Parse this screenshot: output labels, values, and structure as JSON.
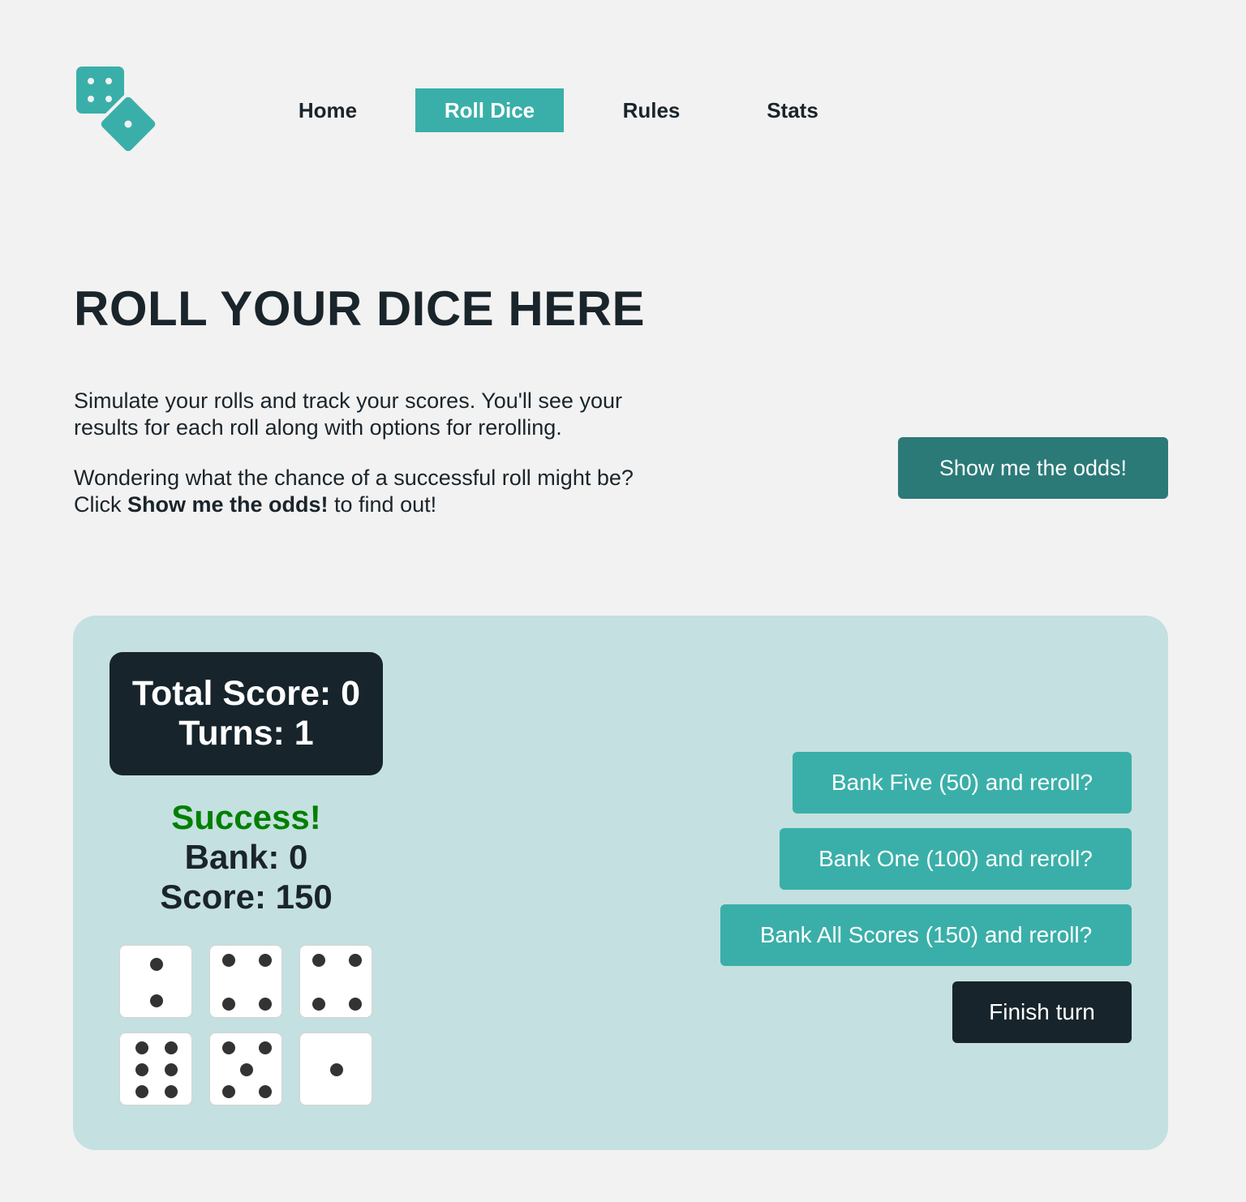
{
  "header": {
    "logo_icon": "dice-logo-icon",
    "nav": [
      {
        "label": "Home",
        "active": false
      },
      {
        "label": "Roll Dice",
        "active": true
      },
      {
        "label": "Rules",
        "active": false
      },
      {
        "label": "Stats",
        "active": false
      }
    ]
  },
  "main": {
    "title": "ROLL YOUR DICE HERE",
    "intro_line1": "Simulate your rolls and track your scores. You'll see your results for each roll along with options for rerolling.",
    "intro_line2_before": "Wondering what the chance of a successful roll might be? Click ",
    "intro_line2_bold": "Show me the odds!",
    "intro_line2_after": " to find out!",
    "odds_button": "Show me the odds!"
  },
  "game": {
    "total_score": "Total Score: 0",
    "turns": "Turns: 1",
    "result_status": "Success!",
    "bank": "Bank: 0",
    "score": "Score: 150",
    "dice": [
      2,
      4,
      4,
      6,
      5,
      1
    ],
    "actions": {
      "bank_five": "Bank Five (50) and reroll?",
      "bank_one": "Bank One (100) and reroll?",
      "bank_all": "Bank All Scores (150) and reroll?",
      "finish": "Finish turn"
    }
  },
  "colors": {
    "accent": "#3aafa9",
    "accent_dark": "#2b7a78",
    "dark": "#17242b",
    "panel": "#c5e0e0",
    "background": "#f2f2f2",
    "success": "#008000"
  }
}
